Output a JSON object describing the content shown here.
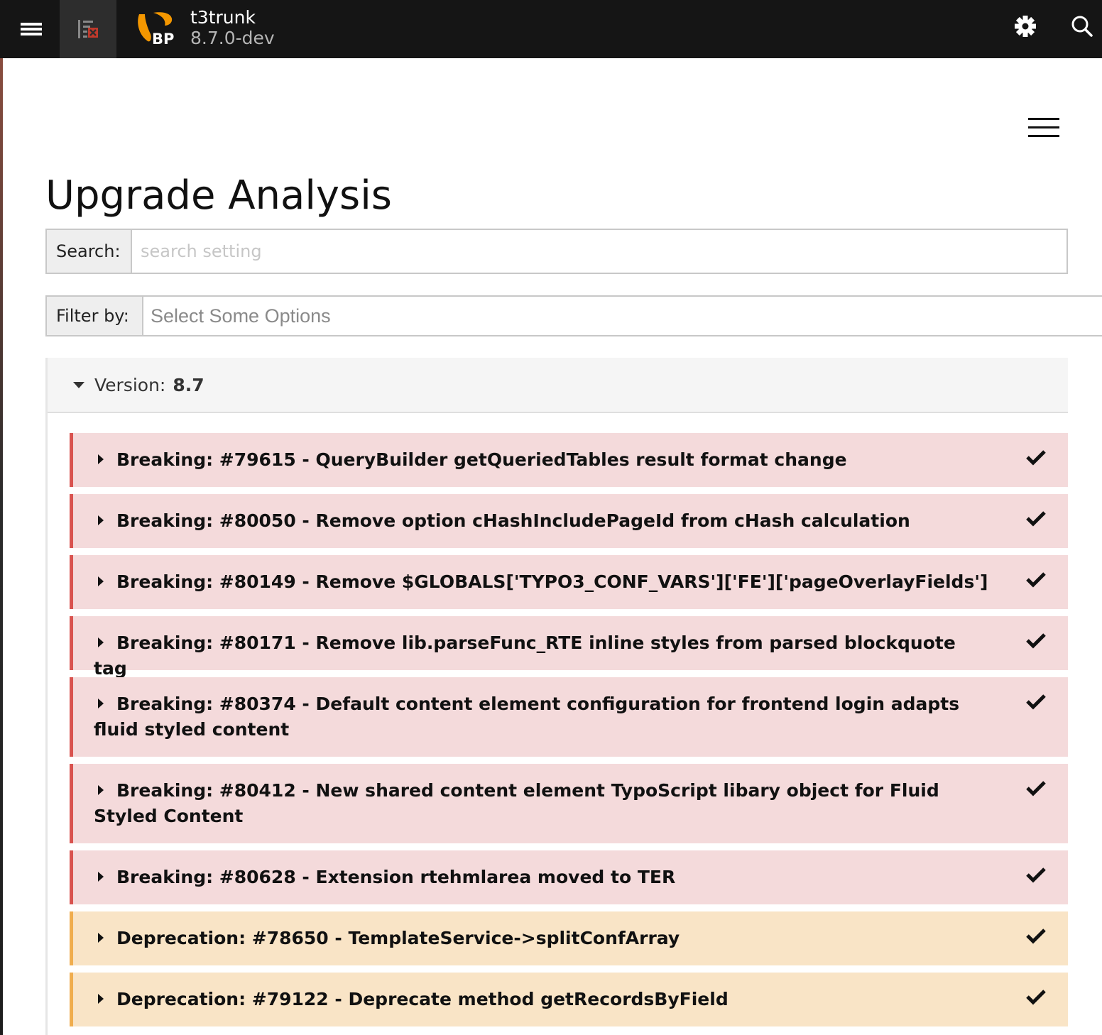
{
  "topbar": {
    "site_name": "t3trunk",
    "site_version": "8.7.0-dev",
    "logo_text": "BP",
    "icons": [
      "menu-icon",
      "pagetree-toggle-icon",
      "typo3-logo",
      "gear-icon",
      "search-icon"
    ]
  },
  "page": {
    "title": "Upgrade Analysis"
  },
  "search": {
    "label": "Search:",
    "placeholder": "search setting",
    "value": ""
  },
  "filter": {
    "label": "Filter by:",
    "placeholder": "Select Some Options"
  },
  "version": {
    "label": "Version:",
    "number": "8.7",
    "expanded": true
  },
  "documents": [
    {
      "type": "breaking",
      "title": "Breaking: #79615 - QueryBuilder getQueriedTables result format change",
      "read": true
    },
    {
      "type": "breaking",
      "title": "Breaking: #80050 - Remove option cHashIncludePageId from cHash calculation",
      "read": true
    },
    {
      "type": "breaking",
      "title": "Breaking: #80149 - Remove $GLOBALS['TYPO3_CONF_VARS']['FE']['pageOverlayFields']",
      "read": true
    },
    {
      "type": "breaking",
      "title": "Breaking: #80171 - Remove lib.parseFunc_RTE inline styles from parsed blockquote tag",
      "read": true
    },
    {
      "type": "breaking",
      "title": "Breaking: #80374 - Default content element configuration for frontend login adapts fluid styled content",
      "read": true
    },
    {
      "type": "breaking",
      "title": "Breaking: #80412 - New shared content element TypoScript libary object for Fluid Styled Content",
      "read": true
    },
    {
      "type": "breaking",
      "title": "Breaking: #80628 - Extension rtehmlarea moved to TER",
      "read": true
    },
    {
      "type": "deprecation",
      "title": "Deprecation: #78650 - TemplateService->splitConfArray",
      "read": true
    },
    {
      "type": "deprecation",
      "title": "Deprecation: #79122 - Deprecate method getRecordsByField",
      "read": true
    }
  ],
  "colors": {
    "topbar_bg": "#151515",
    "breaking_border": "#d9534f",
    "breaking_bg": "#f4dadb",
    "deprecation_border": "#f0ad4e",
    "deprecation_bg": "#f9e4c6",
    "logo_orange": "#f49700"
  }
}
